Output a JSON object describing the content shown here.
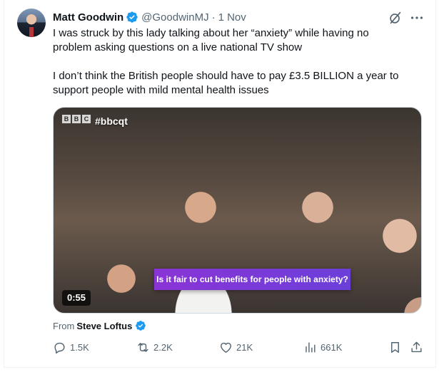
{
  "tweet": {
    "author_name": "Matt Goodwin",
    "author_handle": "@GoodwinMJ",
    "separator": "·",
    "time": "1 Nov",
    "paragraphs": [
      "I was struck by this lady talking about her “anxiety” while having no\nproblem asking questions on a live national TV show",
      "I don’t think the British people should have to pay £3.5 BILLION a year to\nsupport people with mild mental health issues"
    ]
  },
  "media": {
    "logo_letters": [
      "B",
      "B",
      "C"
    ],
    "hashtag": "#bbcqt",
    "caption": "Is it fair to cut benefits for people with anxiety?",
    "duration": "0:55"
  },
  "source": {
    "prefix": "From",
    "name": "Steve Loftus"
  },
  "actions": {
    "replies": "1.5K",
    "reposts": "2.2K",
    "likes": "21K",
    "views": "661K"
  },
  "colors": {
    "verified": "#1d9bf0",
    "secondary_text": "#536471",
    "caption_bg": "#7b3ad8"
  },
  "icons": [
    "verified-badge-icon",
    "grok-icon",
    "more-icon",
    "reply-icon",
    "repost-icon",
    "like-icon",
    "views-icon",
    "bookmark-icon",
    "share-icon"
  ]
}
